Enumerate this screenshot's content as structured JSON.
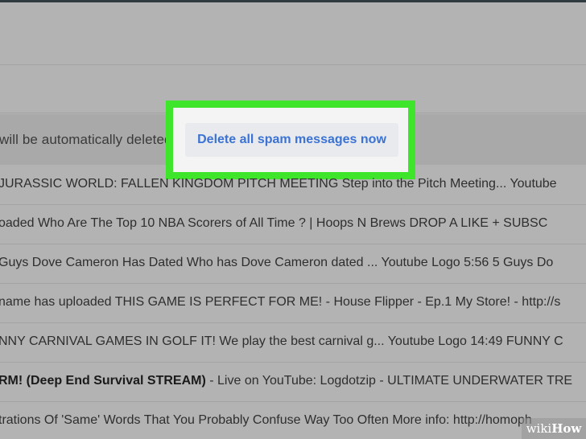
{
  "spam": {
    "notice_text": "will be automatically deleted.",
    "delete_button_label": "Delete all spam messages now"
  },
  "emails": [
    {
      "bold": "",
      "text": "JURASSIC WORLD: FALLEN KINGDOM PITCH MEETING Step into the Pitch Meeting... Youtube"
    },
    {
      "bold": "",
      "text": "oaded Who Are The Top 10 NBA Scorers of All Time ? | Hoops N Brews DROP A LIKE + SUBSC"
    },
    {
      "bold": "",
      "text": "Guys Dove Cameron Has Dated Who has Dove Cameron dated ... Youtube Logo 5:56 5 Guys Do"
    },
    {
      "bold": "",
      "text": "name has uploaded THIS GAME IS PERFECT FOR ME! - House Flipper - Ep.1 My Store! - http://s"
    },
    {
      "bold": "",
      "text": "NNY CARNIVAL GAMES IN GOLF IT! We play the best carnival g... Youtube Logo 14:49 FUNNY C"
    },
    {
      "bold": "RM! (Deep End Survival STREAM)",
      "text": " - Live on YouTube: Logdotzip - ULTIMATE UNDERWATER TRE"
    },
    {
      "bold": "",
      "text": "trations Of 'Same' Words That You Probably Confuse Way Too Often More info: http://homoph"
    }
  ],
  "watermark": {
    "prefix": "wiki",
    "suffix": "How"
  },
  "colors": {
    "highlight_border": "#3ee52a",
    "button_text": "#3b73d4",
    "overlay": "#b3b3b3"
  }
}
